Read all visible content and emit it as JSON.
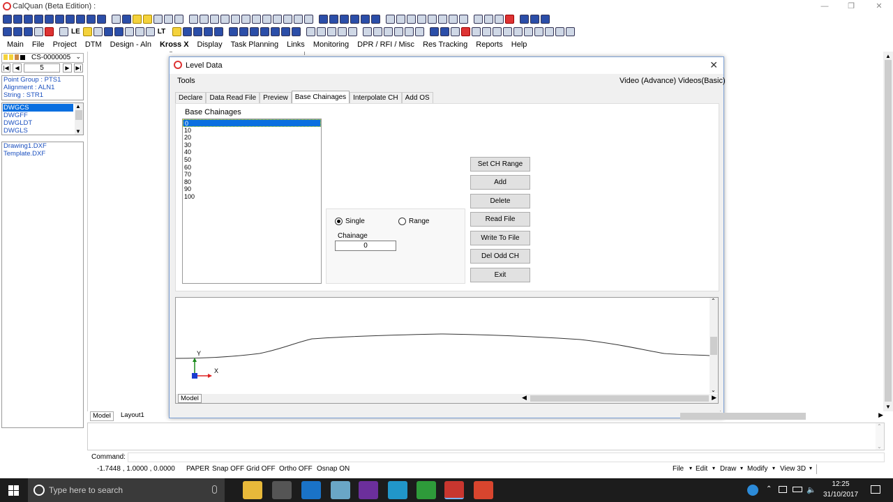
{
  "app": {
    "title": "CalQuan (Beta Edition) :"
  },
  "menubar": [
    "Main",
    "File",
    "Project",
    "DTM",
    "Design - Aln",
    "Kross X",
    "Display",
    "Task Planning",
    "Links",
    "Monitoring",
    "DPR / RFI / Misc",
    "Res Tracking",
    "Reports",
    "Help"
  ],
  "left": {
    "cs_value": "CS-0000005",
    "page": "5",
    "info": [
      "Point Group : PTS1",
      "Alignment : ALN1",
      "String : STR1"
    ],
    "layers": [
      "DWGCS",
      "DWGFF",
      "DWGLDT",
      "DWGLS"
    ],
    "files": [
      "Drawing1.DXF",
      "Template.DXF"
    ]
  },
  "dialog": {
    "title": "Level Data",
    "menu_left": "Tools",
    "menu_right1": "Video (Advance)",
    "menu_right2": "Videos(Basic)",
    "tabs": [
      "Declare",
      "Data Read File",
      "Preview",
      "Base Chainages",
      "Interpolate CH",
      "Add OS"
    ],
    "section_label": "Base Chainages",
    "chainages": [
      "0",
      "10",
      "20",
      "30",
      "40",
      "50",
      "60",
      "70",
      "80",
      "90",
      "100"
    ],
    "radio_single": "Single",
    "radio_range": "Range",
    "chainage_label": "Chainage",
    "chainage_value": "0",
    "buttons": [
      "Set CH Range",
      "Add",
      "Delete",
      "Read File",
      "Write To File",
      "Del Odd CH",
      "Exit"
    ],
    "cad_tab": "Model",
    "axis_y": "Y",
    "axis_x": "X"
  },
  "layout_tabs": [
    "Model",
    "Layout1"
  ],
  "command": {
    "label": "Command:",
    "value": ""
  },
  "status": {
    "coords": "-1.7448 , 1.0000 , 0.0000",
    "toggles": [
      "PAPER",
      "Snap OFF",
      "Grid OFF",
      "Ortho OFF",
      "Osnap ON"
    ],
    "menus": [
      "File",
      "Edit",
      "Draw",
      "Modify",
      "View 3D"
    ]
  },
  "taskbar": {
    "search_placeholder": "Type here to search",
    "time": "12:25",
    "date": "31/10/2017"
  }
}
